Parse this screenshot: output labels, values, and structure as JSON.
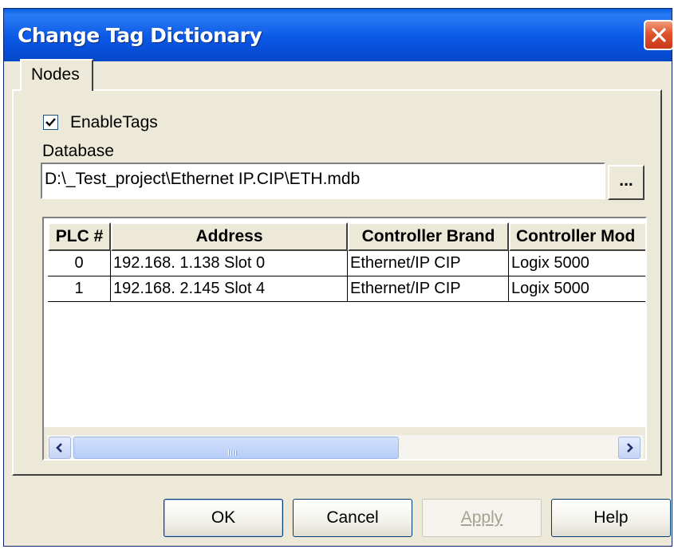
{
  "dialog": {
    "title": "Change Tag Dictionary"
  },
  "tabs": [
    {
      "label": "Nodes",
      "selected": true
    }
  ],
  "options": {
    "enable_tags_label": "EnableTags",
    "enable_tags_checked": true
  },
  "database": {
    "label": "Database",
    "path": "D:\\_Test_project\\Ethernet IP.CIP\\ETH.mdb",
    "browse_label": "..."
  },
  "grid": {
    "columns": [
      "PLC #",
      "Address",
      "Controller Brand",
      "Controller Mod"
    ],
    "rows": [
      {
        "plc": "0",
        "address": "192.168.  1.138 Slot 0",
        "brand": "Ethernet/IP CIP",
        "model": "Logix 5000"
      },
      {
        "plc": "1",
        "address": "192.168.  2.145 Slot 4",
        "brand": "Ethernet/IP CIP",
        "model": "Logix 5000"
      }
    ]
  },
  "buttons": {
    "ok": "OK",
    "cancel": "Cancel",
    "apply": "Apply",
    "help": "Help"
  },
  "icons": {
    "close": "close-icon",
    "checkmark": "checkmark-icon",
    "scroll_left": "arrow-left-icon",
    "scroll_right": "arrow-right-icon"
  },
  "colors": {
    "titlebar": "#0b58e6",
    "close_button": "#e0532c",
    "window_face": "#ece9d8"
  }
}
